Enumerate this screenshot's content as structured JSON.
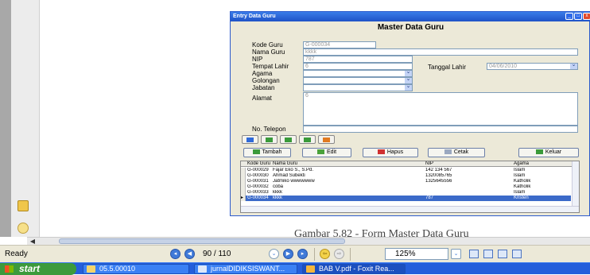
{
  "window": {
    "title": "Entry Data Guru",
    "form_title": "Master Data Guru"
  },
  "form": {
    "kode_guru": {
      "label": "Kode Guru",
      "value": "G-000034"
    },
    "nama_guru": {
      "label": "Nama Guru",
      "value": "kkkk"
    },
    "nip": {
      "label": "NIP",
      "value": "787"
    },
    "tempat_lahir": {
      "label": "Tempat Lahir",
      "value": "6"
    },
    "tanggal_lahir": {
      "label": "Tanggal Lahir",
      "value": "04/06/2010"
    },
    "agama": {
      "label": "Agama",
      "value": ""
    },
    "golongan": {
      "label": "Golongan",
      "value": ""
    },
    "jabatan": {
      "label": "Jabatan",
      "value": ""
    },
    "alamat": {
      "label": "Alamat",
      "value": "6"
    },
    "no_telepon": {
      "label": "No. Telepon",
      "value": ""
    }
  },
  "buttons": {
    "tambah": "Tambah",
    "edit": "Edit",
    "hapus": "Hapus",
    "cetak": "Cetak",
    "keluar": "Keluar"
  },
  "grid": {
    "columns": [
      "Kode Guru",
      "Nama Guru",
      "NIP",
      "Agama"
    ],
    "rows": [
      [
        "G-000029",
        "Fajar Eko S., S.Pd.",
        "142 134 567",
        "Islam"
      ],
      [
        "G-000030",
        "Ahmad Subekti",
        "1320085765",
        "Islam"
      ],
      [
        "G-000031",
        "Jatmiko wwwwwww",
        "1325645556",
        "Katholik"
      ],
      [
        "G-000032",
        "coba",
        "",
        "Katholik"
      ],
      [
        "G-000033",
        "kkkk",
        "",
        "Islam"
      ],
      [
        "G-000034",
        "kkkk",
        "787",
        "Kristen"
      ]
    ],
    "selected_index": 5
  },
  "caption": "Gambar 5.82 - Form Master Data Guru",
  "statusbar": {
    "ready": "Ready",
    "page": "90 / 110",
    "zoom": "125%"
  },
  "taskbar": {
    "start": "start",
    "items": [
      "05.5.00010",
      "jurnalDIDIKSISWANT...",
      "BAB V.pdf - Foxit Rea..."
    ]
  }
}
